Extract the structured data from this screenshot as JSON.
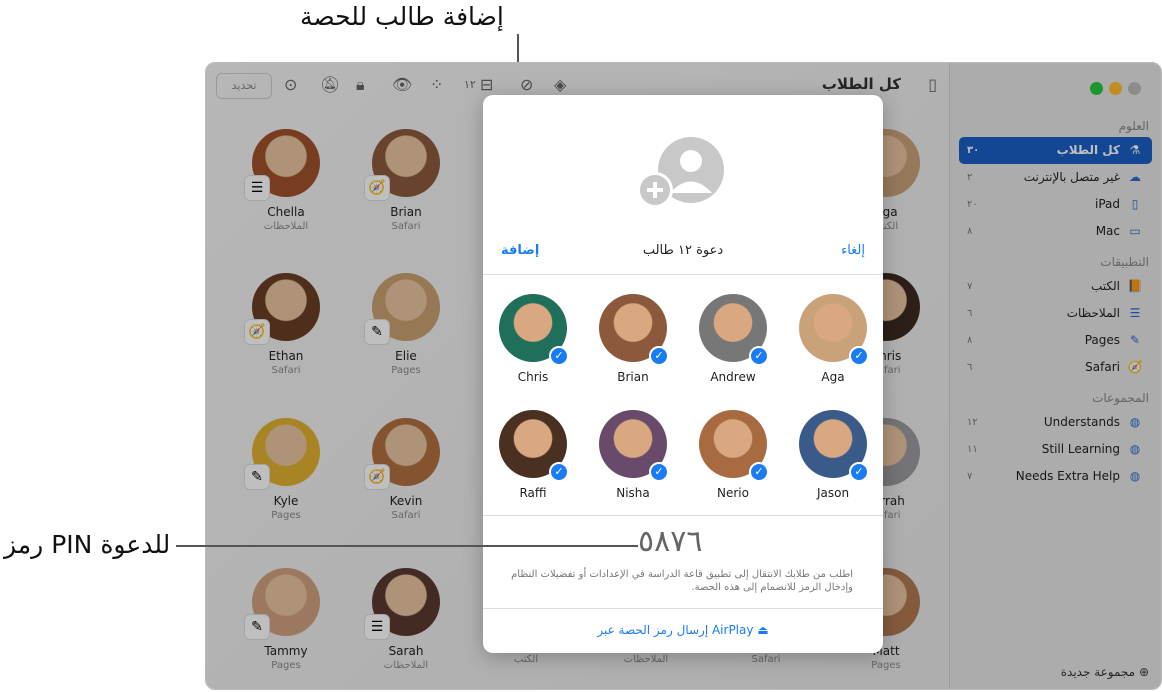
{
  "callouts": {
    "add_student": "إضافة طالب للحصة",
    "pin_code": "رمز PIN للدعوة"
  },
  "toolbar": {
    "title": "كل الطلاب",
    "refresh": "تحديد",
    "inbox_count": "١٢",
    "icons": [
      "sidebar-toggle-icon",
      "layers-icon",
      "compass-icon",
      "inbox-icon",
      "apps-grid-icon",
      "eye-slash-icon",
      "lock-icon",
      "mute-icon",
      "more-icon"
    ]
  },
  "sidebar": {
    "sections": [
      {
        "title": "العلوم",
        "items": [
          {
            "label": "كل الطلاب",
            "count": "٣٠",
            "icon": "microscope-icon",
            "selected": true
          },
          {
            "label": "غير متصل بالإنترنت",
            "count": "٢",
            "icon": "cloud-offline-icon"
          },
          {
            "label": "iPad",
            "count": "٢٠",
            "icon": "ipad-icon"
          },
          {
            "label": "Mac",
            "count": "٨",
            "icon": "laptop-icon"
          }
        ]
      },
      {
        "title": "التطبيقات",
        "items": [
          {
            "label": "الكتب",
            "count": "٧",
            "icon": "books-app-icon"
          },
          {
            "label": "الملاحظات",
            "count": "٦",
            "icon": "notes-app-icon"
          },
          {
            "label": "Pages",
            "count": "٨",
            "icon": "pages-app-icon"
          },
          {
            "label": "Safari",
            "count": "٦",
            "icon": "safari-app-icon"
          }
        ]
      },
      {
        "title": "المجموعات",
        "items": [
          {
            "label": "Understands",
            "count": "١٢",
            "icon": "group-avatars-icon"
          },
          {
            "label": "Still Learning",
            "count": "١١",
            "icon": "group-avatars-icon"
          },
          {
            "label": "Needs Extra Help",
            "count": "٧",
            "icon": "group-avatars-icon"
          }
        ]
      }
    ],
    "new_group": "مجموعة جديدة"
  },
  "students": [
    {
      "name": "Chella",
      "app": "الملاحظات",
      "color": "#a0522d"
    },
    {
      "name": "Brian",
      "app": "Safari",
      "color": "#8b5a3c"
    },
    {
      "name": "",
      "app": "",
      "color": ""
    },
    {
      "name": "",
      "app": "",
      "color": ""
    },
    {
      "name": "",
      "app": "",
      "color": ""
    },
    {
      "name": "Aga",
      "app": "الكتب",
      "color": "#c9a27a"
    },
    {
      "name": "Ethan",
      "app": "Safari",
      "color": "#6b3e26"
    },
    {
      "name": "Elie",
      "app": "Pages",
      "color": "#c8a070"
    },
    {
      "name": "",
      "app": "",
      "color": ""
    },
    {
      "name": "",
      "app": "",
      "color": ""
    },
    {
      "name": "",
      "app": "",
      "color": ""
    },
    {
      "name": "Chris",
      "app": "Safari",
      "color": "#3a2a20"
    },
    {
      "name": "Kyle",
      "app": "Pages",
      "color": "#e0b030"
    },
    {
      "name": "Kevin",
      "app": "Safari",
      "color": "#b07040"
    },
    {
      "name": "",
      "app": "",
      "color": ""
    },
    {
      "name": "",
      "app": "",
      "color": ""
    },
    {
      "name": "",
      "app": "",
      "color": ""
    },
    {
      "name": "Farrah",
      "app": "Safari",
      "color": "#9a9aa0"
    },
    {
      "name": "Tammy",
      "app": "Pages",
      "color": "#d0a080"
    },
    {
      "name": "Sarah",
      "app": "الملاحظات",
      "color": "#5a3a30"
    },
    {
      "name": "",
      "app": "الكتب",
      "color": ""
    },
    {
      "name": "",
      "app": "الملاحظات",
      "color": ""
    },
    {
      "name": "",
      "app": "Safari",
      "color": ""
    },
    {
      "name": "Matt",
      "app": "Pages",
      "color": "#b07850"
    }
  ],
  "popover": {
    "title": "دعوة ١٢ طالب",
    "add": "إضافة",
    "cancel": "إلغاء",
    "students": [
      {
        "name": "Chris",
        "color": "#1f6f5a"
      },
      {
        "name": "Brian",
        "color": "#8b5a3c"
      },
      {
        "name": "Andrew",
        "color": "#777"
      },
      {
        "name": "Aga",
        "color": "#c9a27a"
      },
      {
        "name": "Raffi",
        "color": "#4a3020"
      },
      {
        "name": "Nisha",
        "color": "#6a4a6a"
      },
      {
        "name": "Nerio",
        "color": "#a86a40"
      },
      {
        "name": "Jason",
        "color": "#3a5a8a"
      }
    ],
    "pin": "٥٨٧٦",
    "message": "اطلب من طلابك الانتقال إلى تطبيق قاعة الدراسة في الإعدادات أو تفضيلات النظام وإدخال الرمز للانضمام إلى هذه الحصة.",
    "airplay": "إرسال رمز الحصة عبر AirPlay"
  },
  "colors": {
    "accent": "#1a7cf5",
    "selected": "#1a5fc4",
    "close": "#27c93f",
    "minimize": "#ffbd2e"
  }
}
